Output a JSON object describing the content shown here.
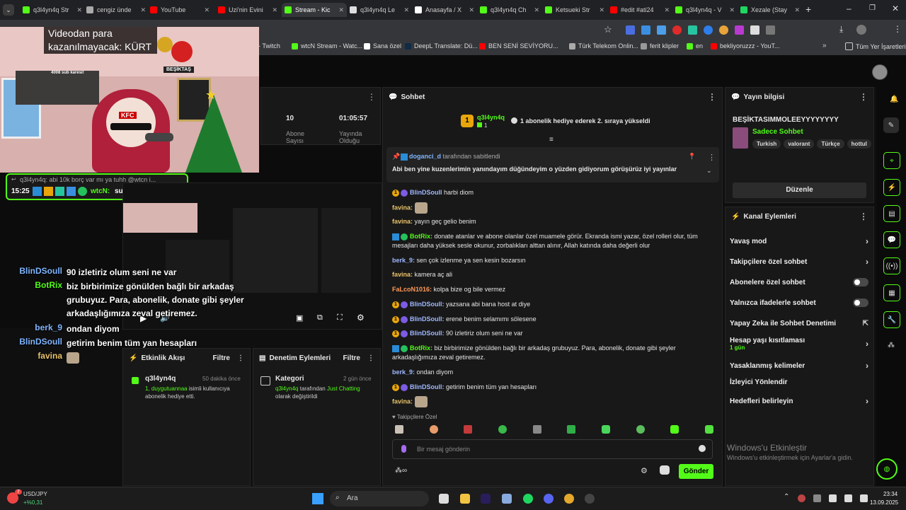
{
  "tabs": [
    {
      "title": "q3l4yn4q Str",
      "color": "#53fc18"
    },
    {
      "title": "cengiz ünde",
      "color": "#aaaaaa"
    },
    {
      "title": "YouTube",
      "color": "#ff0000"
    },
    {
      "title": "Uzi'nin Evini",
      "color": "#ff0000"
    },
    {
      "title": "Stream - Kic",
      "color": "#53fc18"
    },
    {
      "title": "q3l4yn4q Le",
      "color": "#dddddd"
    },
    {
      "title": "Anasayfa / X",
      "color": "#ffffff"
    },
    {
      "title": "q3l4yn4q Ch",
      "color": "#53fc18"
    },
    {
      "title": "Ketsueki Str",
      "color": "#53fc18"
    },
    {
      "title": "#edit #ati24",
      "color": "#ff0000"
    },
    {
      "title": "q3l4yn4q - V",
      "color": "#53fc18"
    },
    {
      "title": "Xezale (Stay",
      "color": "#1ed760"
    }
  ],
  "bookmarks": [
    {
      "label": "- Twitch",
      "color": "#9146ff"
    },
    {
      "label": "wtcN Stream - Watc...",
      "color": "#53fc18"
    },
    {
      "label": "Sana özel",
      "color": "#ffffff"
    },
    {
      "label": "DeepL Translate: Dü...",
      "color": "#0f2b46"
    },
    {
      "label": "BEN SENİ SEVİYORU...",
      "color": "#ff0000"
    },
    {
      "label": "Türk Telekom Onlin...",
      "color": "#aaaaaa"
    },
    {
      "label": "ferit klipler",
      "color": "#999999"
    },
    {
      "label": "en",
      "color": "#53fc18"
    },
    {
      "label": "bekliyoruzzz - YouT...",
      "color": "#ff0000"
    }
  ],
  "all_bookmarks": "Tüm Yer İşaretleri",
  "overlay": {
    "caption": "Videodan para kazanılmayacak: KÜRT",
    "sub_count": "4008 sub karesi!",
    "besiktas": "BEŞİKTAŞ",
    "brand": "KFC",
    "reply_line": "q3l4yn4q: abi 10k borç var mı ya tuhh @wtcn i...",
    "time": "15:25",
    "reply_user": "wtcN:",
    "reply_msg": "sus lan çalış",
    "chat": [
      {
        "user": "BlinDSoull",
        "msg": "90 izletiriz olum seni ne var",
        "color": "#7fb5ff"
      },
      {
        "user": "BotRix",
        "msg": "biz birbirimize gönülden bağlı bir arkadaş grubuyuz. Para, abonelik, donate gibi şeyler arkadaşlığımıza zeval getiremez.",
        "color": "#53fc18"
      },
      {
        "user": "berk_9",
        "msg": "ondan diyom",
        "color": "#7fb5ff"
      },
      {
        "user": "BlinDSoull",
        "msg": "getirim benim tüm yan hesapları",
        "color": "#7fb5ff"
      },
      {
        "user": "favina",
        "msg": "",
        "color": "#e8c36a"
      }
    ]
  },
  "stats": {
    "subs": "10",
    "subs_label": "Abone Sayısı",
    "uptime": "01:05:57",
    "uptime_label": "Yayında Olduğu"
  },
  "activity": {
    "title": "Etkinlik Akışı",
    "filter": "Filtre",
    "user": "q3l4yn4q",
    "ago": "50 dakika önce",
    "desc_user": "1, duygutuannaa",
    "desc": "isimli kullanıcıya abonelik hediye etti."
  },
  "moderation": {
    "title": "Denetim Eylemleri",
    "filter": "Filtre",
    "label": "Kategori",
    "ago": "2 gün önce",
    "desc_user": "q3l4yn4q",
    "desc": "tarafından",
    "desc_cat": "Just Chatting",
    "desc_end": "olarak değiştirildi"
  },
  "chat": {
    "title": "Sohbet",
    "gifter": "q3l4yn4q",
    "gifter_count": "1",
    "gift_msg": "1 abonelik hediye ederek 2. sıraya yükseldi",
    "pinned_by": "doganci_d",
    "pinned_suffix": "tarafından sabitlendi",
    "pinned_msg": "Abi ben yine kuzenlerimin yanındayım düğündeyim o yüzden gidiyorum görüşürüz iyi yayınlar",
    "messages": [
      {
        "user": "BlinDSoull",
        "msg": "harbi diom",
        "color": "#9fb8ff",
        "badges": "1p"
      },
      {
        "user": "favina:",
        "msg": "",
        "color": "#e8c36a",
        "badges": "",
        "emote": true
      },
      {
        "user": "favina:",
        "msg": "yayın geç gelio benim",
        "color": "#e8c36a",
        "badges": ""
      },
      {
        "user": "BotRix:",
        "msg": "donate atanlar ve abone olanlar özel muamele görür. Ekranda ismi yazar, özel rolleri olur, tüm mesajları daha yüksek sesle okunur, zorbalıkları alttan alınır, Allah katında daha değerli olur",
        "color": "#53fc18",
        "badges": "bg"
      },
      {
        "user": "berk_9:",
        "msg": "sen çok izlenme ya sen kesin bozarsın",
        "color": "#9fb8ff",
        "badges": ""
      },
      {
        "user": "favina:",
        "msg": "kamera aç ali",
        "color": "#e8c36a",
        "badges": ""
      },
      {
        "user": "FaLcoN1016:",
        "msg": "kolpa bize og bile vermez",
        "color": "#ff9a5a",
        "badges": ""
      },
      {
        "user": "BlinDSoull:",
        "msg": "yazsana abi bana host at diye",
        "color": "#9fb8ff",
        "badges": "1p"
      },
      {
        "user": "BlinDSoull:",
        "msg": "erene benim selamımı sölesene",
        "color": "#9fb8ff",
        "badges": "1p"
      },
      {
        "user": "BlinDSoull:",
        "msg": "90 izletiriz olum seni ne var",
        "color": "#9fb8ff",
        "badges": "1p"
      },
      {
        "user": "BotRix:",
        "msg": "biz birbirimize gönülden bağlı bir arkadaş grubuyuz. Para, abonelik, donate gibi şeyler arkadaşlığımıza zeval getiremez.",
        "color": "#53fc18",
        "badges": "bg"
      },
      {
        "user": "berk_9:",
        "msg": "ondan diyom",
        "color": "#9fb8ff",
        "badges": ""
      },
      {
        "user": "BlinDSoull:",
        "msg": "getirim benim tüm yan hesapları",
        "color": "#9fb8ff",
        "badges": "1p"
      },
      {
        "user": "favina:",
        "msg": "",
        "color": "#e8c36a",
        "badges": "",
        "emote": true
      }
    ],
    "followers_only": "Takipçilere Özel",
    "placeholder": "Bir mesaj gönderin",
    "send": "Gönder"
  },
  "stream_info": {
    "title": "Yayın bilgisi",
    "stream_title": "BEŞİKTASIMMOLEEYYYYYYYY",
    "category": "Sadece Sohbet",
    "tags": [
      "Turkish",
      "valorant",
      "Türkçe",
      "hottul"
    ],
    "edit": "Düzenle"
  },
  "channel_actions": {
    "title": "Kanal Eylemleri",
    "items": [
      {
        "label": "Yavaş mod",
        "type": "chev"
      },
      {
        "label": "Takipçilere özel sohbet",
        "type": "chev"
      },
      {
        "label": "Abonelere özel sohbet",
        "type": "toggle"
      },
      {
        "label": "Yalnızca ifadelerle sohbet",
        "type": "toggle"
      },
      {
        "label": "Yapay Zeka ile Sohbet Denetimi",
        "type": "ext"
      },
      {
        "label": "Hesap yaşı kısıtlaması",
        "type": "chev",
        "sub": "1 gün"
      },
      {
        "label": "Yasaklanmış kelimeler",
        "type": "chev"
      },
      {
        "label": "İzleyici Yönlendir",
        "type": "none"
      },
      {
        "label": "Hedefleri belirleyin",
        "type": "chev"
      }
    ]
  },
  "watermark": {
    "title": "Windows'u Etkinleştir",
    "sub": "Windows'u etkinleştirmek için Ayarlar'a gidin."
  },
  "taskbar": {
    "ticker": "USD/JPY",
    "change": "+%0,31",
    "alert": "7",
    "search": "Ara",
    "time": "23:34",
    "date": "13.09.2025"
  }
}
